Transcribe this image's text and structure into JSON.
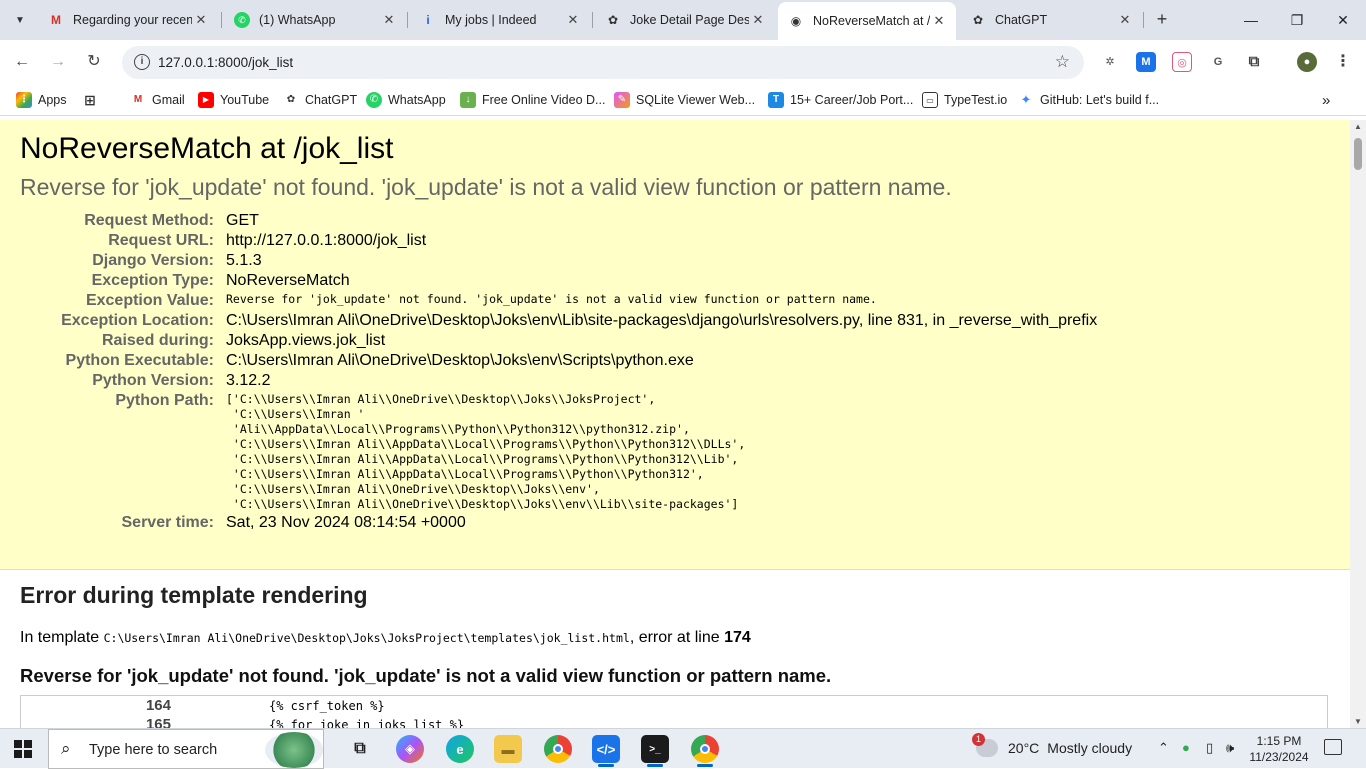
{
  "tabs": [
    {
      "title": "Regarding your recen",
      "icon": "gmail-icon"
    },
    {
      "title": "(1) WhatsApp",
      "icon": "whatsapp-icon"
    },
    {
      "title": "My jobs | Indeed",
      "icon": "indeed-icon"
    },
    {
      "title": "Joke Detail Page Des",
      "icon": "chatgpt-icon"
    },
    {
      "title": "NoReverseMatch at /",
      "icon": "django-icon"
    },
    {
      "title": "ChatGPT",
      "icon": "chatgpt-icon"
    }
  ],
  "address_bar": {
    "url": "127.0.0.1:8000/jok_list"
  },
  "bookmarks": [
    {
      "label": "Apps"
    },
    {
      "label": "Gmail"
    },
    {
      "label": "YouTube"
    },
    {
      "label": "ChatGPT"
    },
    {
      "label": "WhatsApp"
    },
    {
      "label": "Free Online Video D..."
    },
    {
      "label": "SQLite Viewer Web..."
    },
    {
      "label": "15+ Career/Job Port..."
    },
    {
      "label": "TypeTest.io"
    },
    {
      "label": "GitHub: Let's build f..."
    }
  ],
  "error": {
    "title": "NoReverseMatch at /jok_list",
    "message": "Reverse for 'jok_update' not found. 'jok_update' is not a valid view function or pattern name.",
    "rows": [
      {
        "label": "Request Method:",
        "value": "GET"
      },
      {
        "label": "Request URL:",
        "value": "http://127.0.0.1:8000/jok_list"
      },
      {
        "label": "Django Version:",
        "value": "5.1.3"
      },
      {
        "label": "Exception Type:",
        "value": "NoReverseMatch"
      },
      {
        "label": "Exception Value:",
        "value": "Reverse for 'jok_update' not found. 'jok_update' is not a valid view function or pattern name."
      },
      {
        "label": "Exception Location:",
        "value": "C:\\Users\\Imran Ali\\OneDrive\\Desktop\\Joks\\env\\Lib\\site-packages\\django\\urls\\resolvers.py, line 831, in _reverse_with_prefix"
      },
      {
        "label": "Raised during:",
        "value": "JoksApp.views.jok_list"
      },
      {
        "label": "Python Executable:",
        "value": "C:\\Users\\Imran Ali\\OneDrive\\Desktop\\Joks\\env\\Scripts\\python.exe"
      },
      {
        "label": "Python Version:",
        "value": "3.12.2"
      },
      {
        "label": "Python Path:",
        "value": "['C:\\\\Users\\\\Imran Ali\\\\OneDrive\\\\Desktop\\\\Joks\\\\JoksProject',\n 'C:\\\\Users\\\\Imran '\n 'Ali\\\\AppData\\\\Local\\\\Programs\\\\Python\\\\Python312\\\\python312.zip',\n 'C:\\\\Users\\\\Imran Ali\\\\AppData\\\\Local\\\\Programs\\\\Python\\\\Python312\\\\DLLs',\n 'C:\\\\Users\\\\Imran Ali\\\\AppData\\\\Local\\\\Programs\\\\Python\\\\Python312\\\\Lib',\n 'C:\\\\Users\\\\Imran Ali\\\\AppData\\\\Local\\\\Programs\\\\Python\\\\Python312',\n 'C:\\\\Users\\\\Imran Ali\\\\OneDrive\\\\Desktop\\\\Joks\\\\env',\n 'C:\\\\Users\\\\Imran Ali\\\\OneDrive\\\\Desktop\\\\Joks\\\\env\\\\Lib\\\\site-packages']"
      },
      {
        "label": "Server time:",
        "value": "Sat, 23 Nov 2024 08:14:54 +0000"
      }
    ]
  },
  "template_error": {
    "heading": "Error during template rendering",
    "in_template_prefix": "In template",
    "template_path": "C:\\Users\\Imran Ali\\OneDrive\\Desktop\\Joks\\JoksProject\\templates\\jok_list.html",
    "error_at_line_text": ", error at line",
    "line_number": "174",
    "message": "Reverse for 'jok_update' not found. 'jok_update' is not a valid view function or pattern name.",
    "source_lines": [
      {
        "num": "164",
        "code": "{% csrf_token %}"
      },
      {
        "num": "165",
        "code": "{% for joke in joks_list %}"
      }
    ]
  },
  "taskbar": {
    "search_placeholder": "Type here to search",
    "weather": {
      "temp": "20°C",
      "condition": "Mostly cloudy",
      "badge": "1"
    },
    "time": "1:15 PM",
    "date": "11/23/2024"
  },
  "colors": {
    "summary_bg": "#ffffc8",
    "accent": "#0067c0"
  }
}
